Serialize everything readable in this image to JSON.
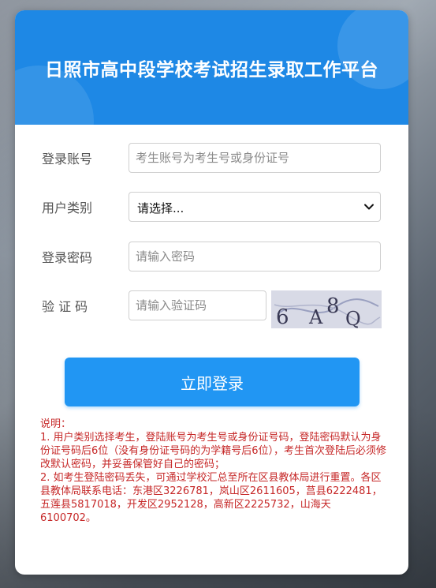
{
  "header": {
    "title": "日照市高中段学校考试招生录取工作平台"
  },
  "form": {
    "account": {
      "label": "登录账号",
      "placeholder": "考生账号为考生号或身份证号",
      "value": ""
    },
    "user_type": {
      "label": "用户类别",
      "selected": "请选择..."
    },
    "password": {
      "label": "登录密码",
      "placeholder": "请输入密码",
      "value": ""
    },
    "captcha": {
      "label": "验 证 码",
      "placeholder": "请输入验证码",
      "value": "",
      "image_text": "6A8Q"
    },
    "submit_label": "立即登录"
  },
  "notes": {
    "title": "说明：",
    "item1": "1. 用户类别选择考生，登陆账号为考生号或身份证号码，登陆密码默认为身份证号码后6位（没有身份证号码的为学籍号后6位），考生首次登陆后必须修改默认密码，并妥善保管好自己的密码；",
    "item2": "2. 如考生登陆密码丢失，可通过学校汇总至所在区县教体局进行重置。各区县教体局联系电话：东港区3226781，岚山区2611605，莒县6222481，五莲县5817018，开发区2952128，高新区2225732，山海天 6100702。"
  },
  "colors": {
    "header_bg": "#1e88e5",
    "button_bg": "#2196f3",
    "notes_text": "#c62828"
  }
}
